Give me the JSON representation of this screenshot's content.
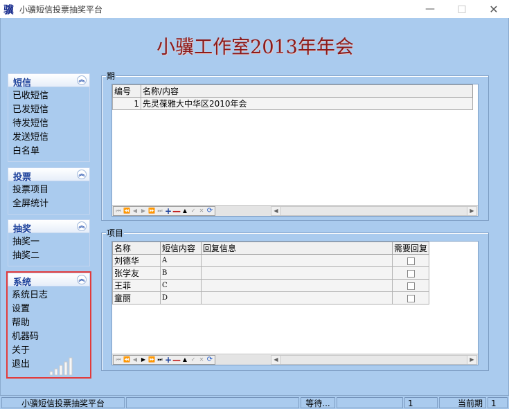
{
  "window": {
    "icon_glyph": "骥",
    "title": "小骥短信投票抽奖平台"
  },
  "banner": "小骥工作室2013年年会",
  "nav": {
    "sms": {
      "title": "短信",
      "items": [
        "已收短信",
        "已发短信",
        "待发短信",
        "发送短信",
        "白名单"
      ]
    },
    "vote": {
      "title": "投票",
      "items": [
        "投票项目",
        "全屏统计"
      ]
    },
    "lottery": {
      "title": "抽奖",
      "items": [
        "抽奖一",
        "抽奖二"
      ]
    },
    "system": {
      "title": "系统",
      "items": [
        "系统日志",
        "设置",
        "帮助",
        "机器码",
        "关于",
        "退出"
      ]
    }
  },
  "period_box": {
    "legend": "期",
    "columns": [
      "编号",
      "名称/内容"
    ],
    "rows": [
      {
        "id": "1",
        "name": "先灵葆雅大中华区2010年会"
      }
    ]
  },
  "items_box": {
    "legend": "项目",
    "columns": [
      "名称",
      "短信内容",
      "回复信息",
      "需要回复"
    ],
    "rows": [
      {
        "name": "刘德华",
        "sms": "A",
        "reply": "",
        "need_reply": false
      },
      {
        "name": "张学友",
        "sms": "B",
        "reply": "",
        "need_reply": false
      },
      {
        "name": "王菲",
        "sms": "C",
        "reply": "",
        "need_reply": false
      },
      {
        "name": "童丽",
        "sms": "D",
        "reply": "",
        "need_reply": false
      }
    ]
  },
  "statusbar": {
    "app_name": "小骥短信投票抽奖平台",
    "state": "等待...",
    "count": "1",
    "current_period_label": "当前期号：",
    "current_period_value": "1"
  },
  "colors": {
    "background": "#aacbee",
    "banner_text": "#8b1a1a",
    "group_header_text": "#1a3f9a",
    "highlight_border": "#e23a3a"
  }
}
